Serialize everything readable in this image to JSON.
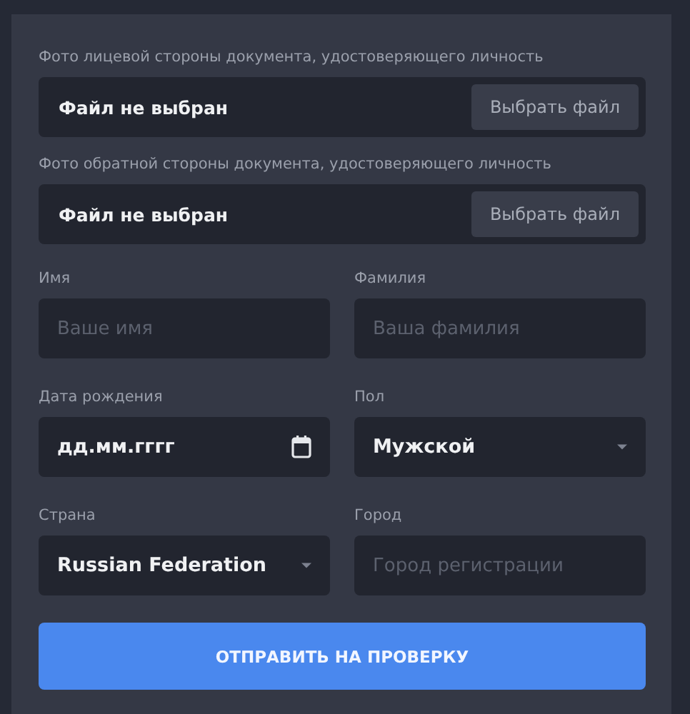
{
  "file_fields": [
    {
      "label": "Фото лицевой стороны документа, удостоверяющего личность",
      "status": "Файл не выбран",
      "button": "Выбрать файл"
    },
    {
      "label": "Фото обратной стороны документа, удостоверяющего личность",
      "status": "Файл не выбран",
      "button": "Выбрать файл"
    }
  ],
  "fields": [
    {
      "kind": "text",
      "label": "Имя",
      "placeholder": "Ваше имя"
    },
    {
      "kind": "text",
      "label": "Фамилия",
      "placeholder": "Ваша фамилия"
    },
    {
      "kind": "date",
      "label": "Дата рождения",
      "value": "дд.мм.гггг"
    },
    {
      "kind": "select",
      "label": "Пол",
      "value": "Мужской"
    },
    {
      "kind": "select",
      "label": "Страна",
      "value": "Russian Federation"
    },
    {
      "kind": "text",
      "label": "Город",
      "placeholder": "Город регистрации"
    }
  ],
  "submit": "ОТПРАВИТЬ НА ПРОВЕРКУ"
}
